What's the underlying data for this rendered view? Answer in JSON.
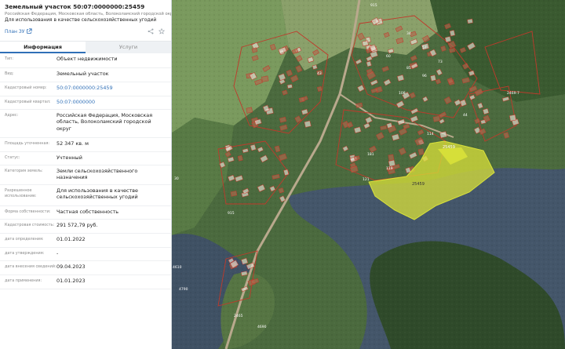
{
  "header": {
    "title": "Земельный участок 50:07:0000000:25459",
    "address": "Российская Федерация, Московская область, Волоколамский городской округ",
    "use": "Для использования в качестве сельскохозяйственных угодий",
    "plan_link": "План ЗУ"
  },
  "tabs": [
    {
      "label": "Информация",
      "active": true
    },
    {
      "label": "Услуги",
      "active": false
    }
  ],
  "rows": [
    {
      "label": "Тип:",
      "value": "Объект недвижимости"
    },
    {
      "label": "Вид:",
      "value": "Земельный участок"
    },
    {
      "label": "Кадастровый номер:",
      "value": "50:07:0000000:25459"
    },
    {
      "label": "Кадастровый квартал:",
      "value": "50:07:0000000"
    },
    {
      "label": "Адрес:",
      "value": "Российская Федерация, Московская область, Волоколамский городской округ"
    },
    {
      "label": "Площадь уточненная:",
      "value": "52 347 кв. м"
    },
    {
      "label": "Статус:",
      "value": "Учтенный"
    },
    {
      "label": "Категория земель:",
      "value": "Земли сельскохозяйственного назначения"
    },
    {
      "label": "Разрешенное использование:",
      "value": "Для использования в качестве сельскохозяйственных угодий"
    },
    {
      "label": "Форма собственности:",
      "value": "Частная собственность"
    },
    {
      "label": "Кадастровая стоимость:",
      "value": "291 572,79 руб."
    },
    {
      "label": "дата определения:",
      "value": "01.01.2022"
    },
    {
      "label": "дата утверждения:",
      "value": "-"
    },
    {
      "label": "дата внесения сведений:",
      "value": "09.04.2023"
    },
    {
      "label": "дата применения:",
      "value": "01.01.2023"
    }
  ],
  "map": {
    "selected_label": "25459",
    "selected_tag": "25459",
    "parcel_labels": [
      "2469:7",
      "915",
      "30",
      "4790",
      "4690",
      "4610",
      "2465",
      "915",
      "60",
      "34",
      "44",
      "119",
      "181",
      "114",
      "96",
      "108",
      "57",
      "73",
      "85",
      "43",
      "121"
    ],
    "colors": {
      "selected_fill": "#d9e23a",
      "parcel_outline": "#c0392b",
      "water": "#44566a",
      "forest": "#2f4a2a",
      "field": "#6d8a55"
    }
  }
}
